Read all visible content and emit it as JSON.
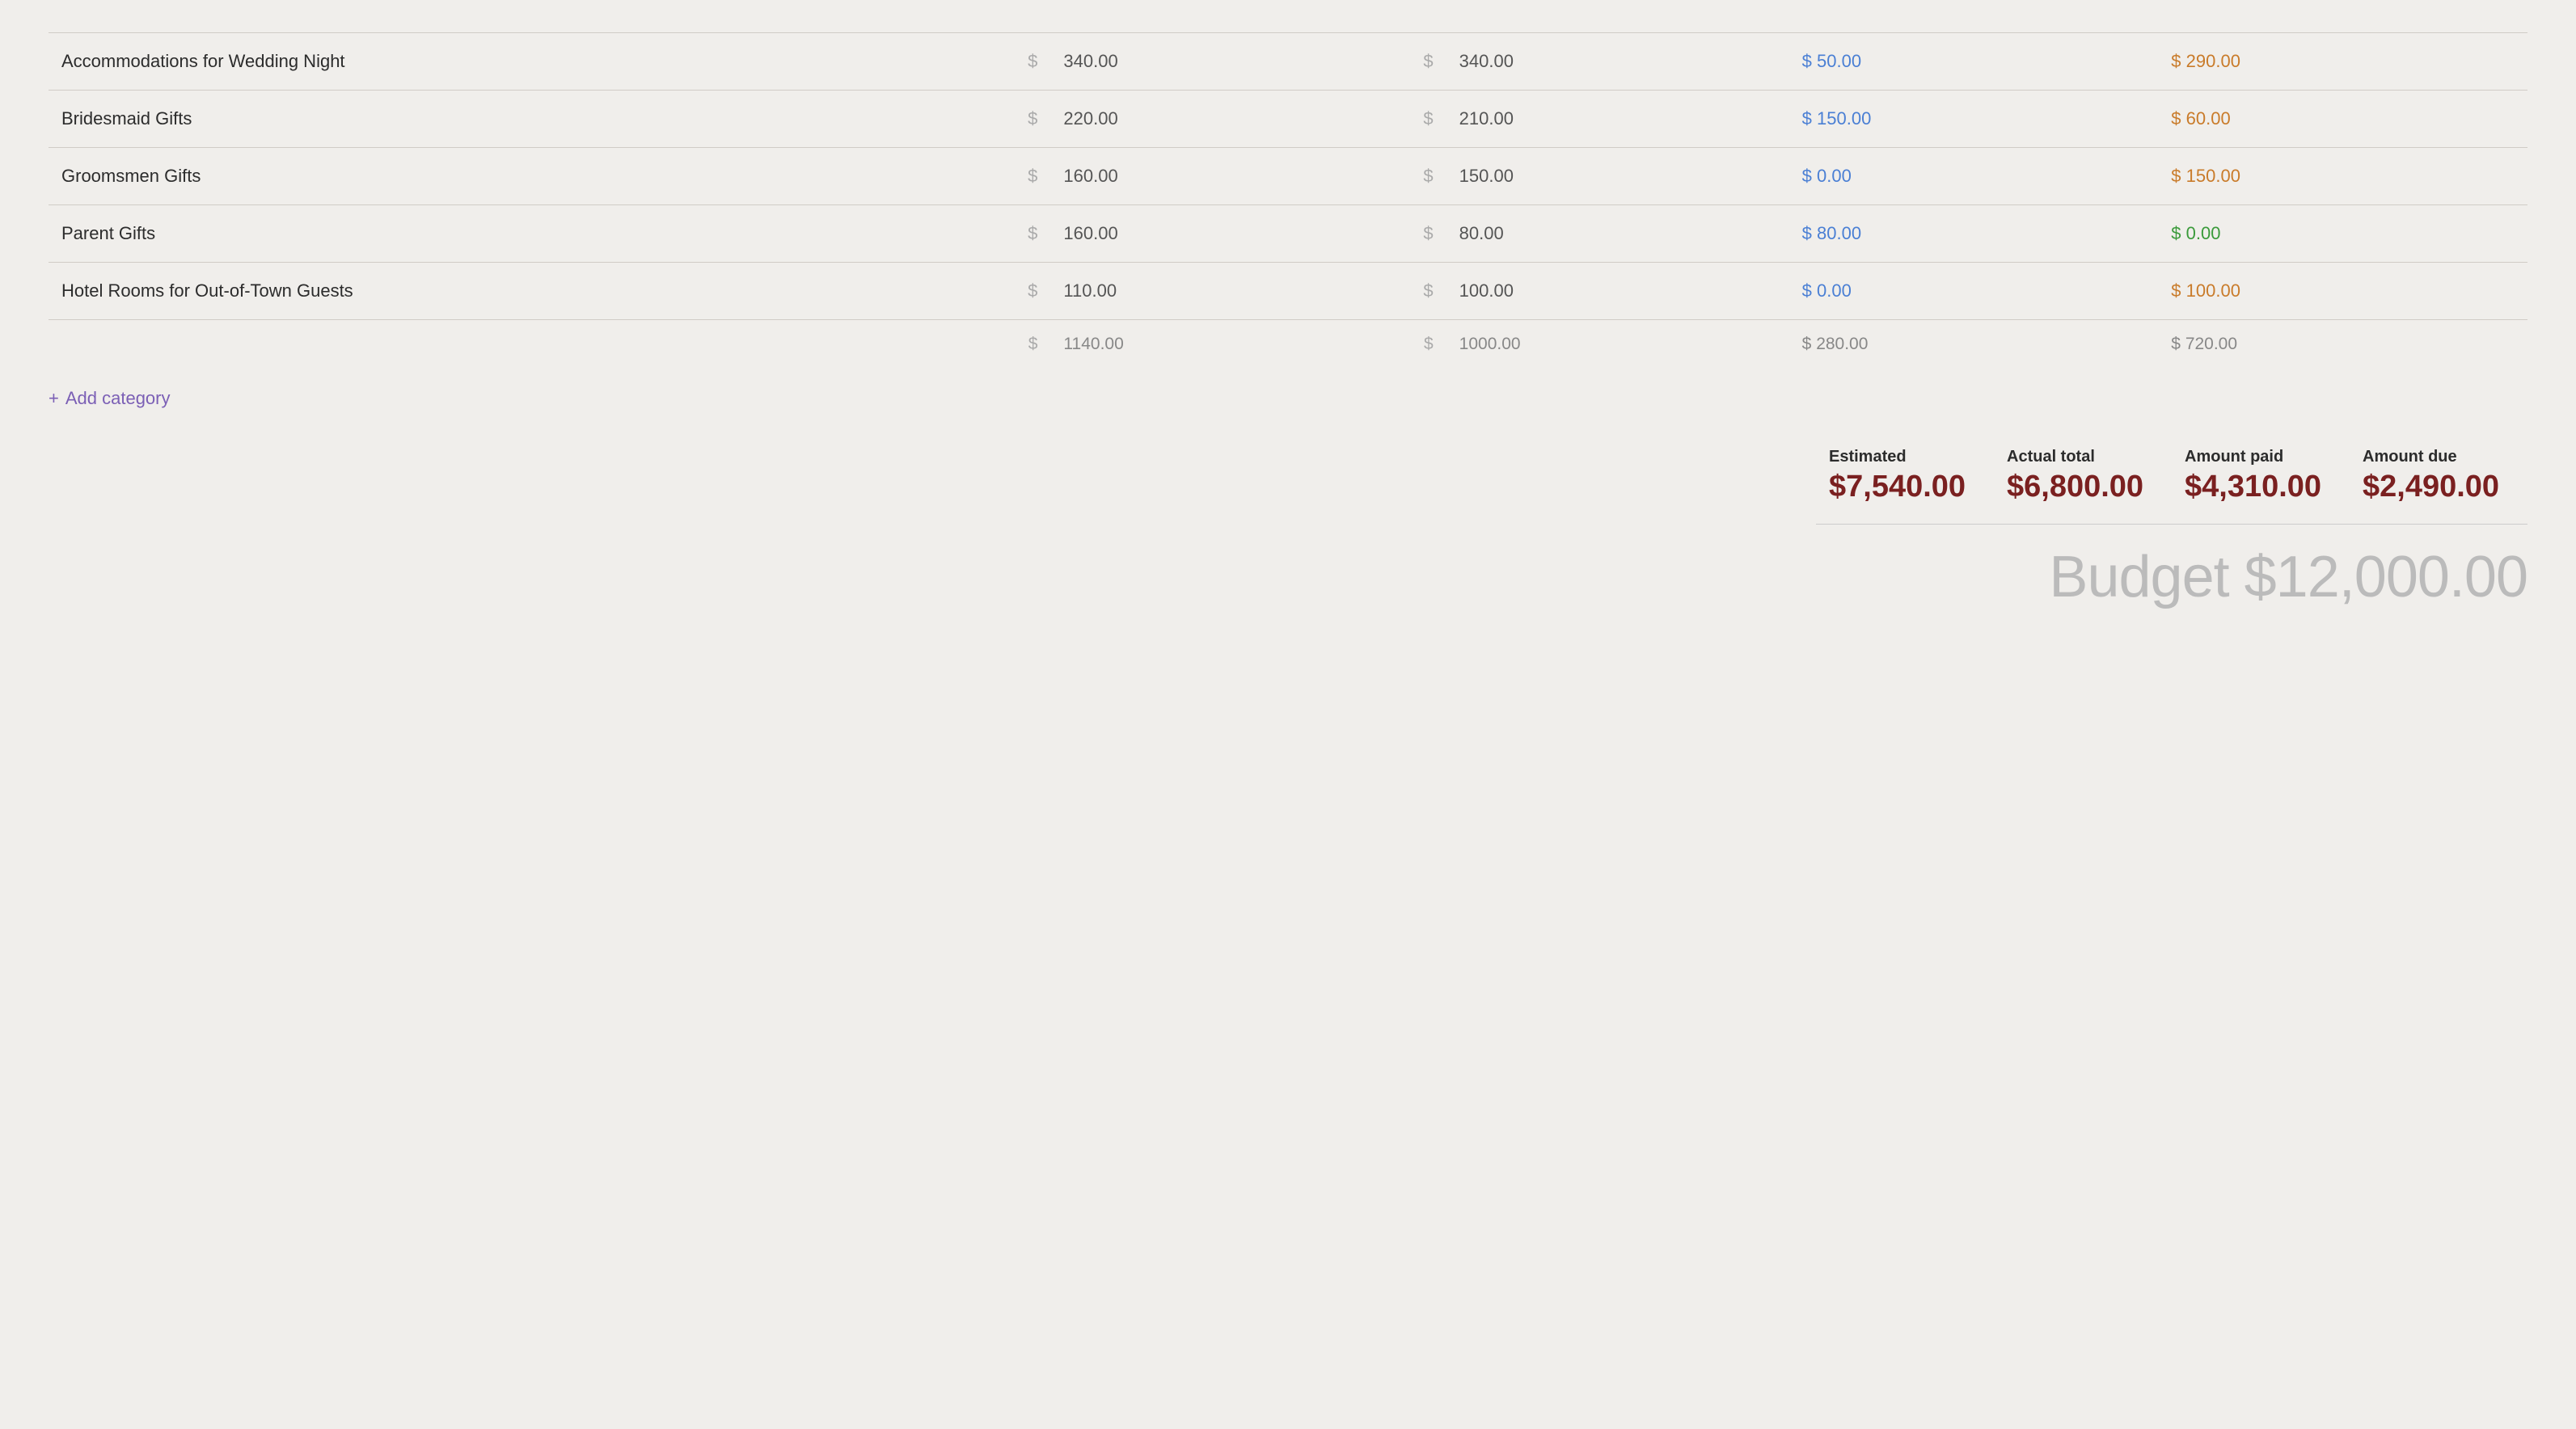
{
  "rows": [
    {
      "name": "Accommodations for Wedding Night",
      "estimated": "340.00",
      "actual": "340.00",
      "paid": "50.00",
      "due": "290.00",
      "paid_color": "blue",
      "due_color": "orange"
    },
    {
      "name": "Bridesmaid Gifts",
      "estimated": "220.00",
      "actual": "210.00",
      "paid": "150.00",
      "due": "60.00",
      "paid_color": "blue",
      "due_color": "orange"
    },
    {
      "name": "Groomsmen Gifts",
      "estimated": "160.00",
      "actual": "150.00",
      "paid": "0.00",
      "due": "150.00",
      "paid_color": "blue",
      "due_color": "orange"
    },
    {
      "name": "Parent Gifts",
      "estimated": "160.00",
      "actual": "80.00",
      "paid": "80.00",
      "due": "0.00",
      "paid_color": "blue",
      "due_color": "green"
    },
    {
      "name": "Hotel Rooms for Out-of-Town Guests",
      "estimated": "110.00",
      "actual": "100.00",
      "paid": "0.00",
      "due": "100.00",
      "paid_color": "blue",
      "due_color": "orange"
    }
  ],
  "subtotals": {
    "estimated": "1140.00",
    "actual": "1000.00",
    "paid": "280.00",
    "due": "720.00"
  },
  "add_category_label": "Add category",
  "summary": {
    "estimated_label": "Estimated",
    "estimated_value": "$7,540.00",
    "actual_label": "Actual total",
    "actual_value": "$6,800.00",
    "paid_label": "Amount paid",
    "paid_value": "$4,310.00",
    "due_label": "Amount due",
    "due_value": "$2,490.00"
  },
  "budget": {
    "label": "Budget",
    "value": "$12,000.00"
  },
  "currency_symbol": "$"
}
